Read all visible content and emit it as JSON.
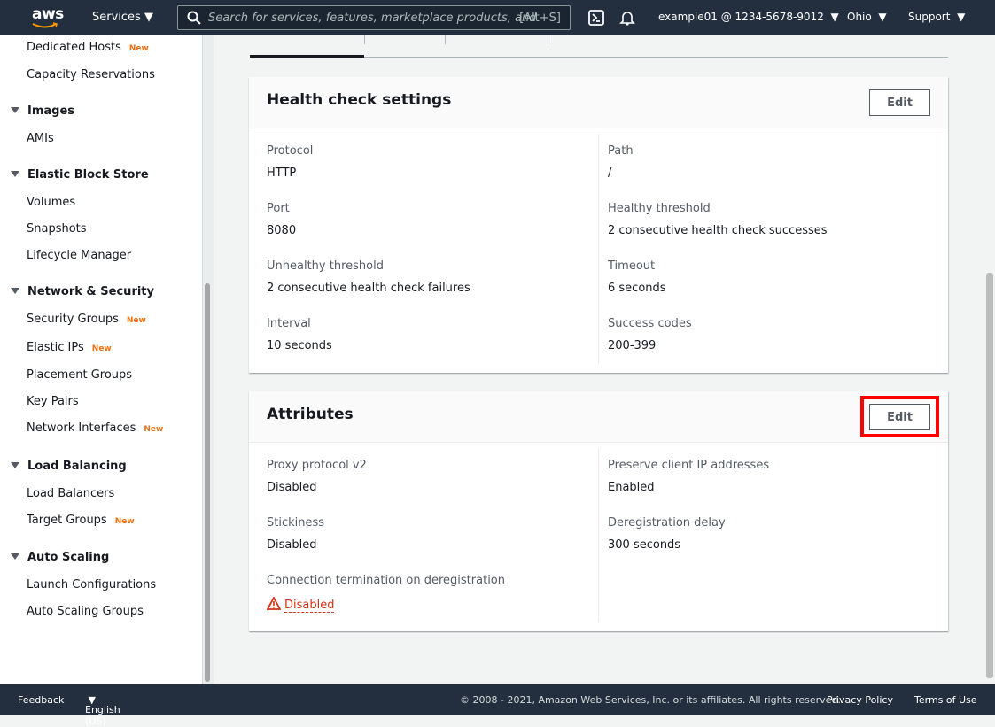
{
  "header": {
    "logo": "aws",
    "services": "Services",
    "search_placeholder": "Search for services, features, marketplace products, and",
    "search_shortcut": "[Alt+S]",
    "account": "example01 @ 1234-5678-9012",
    "region": "Ohio",
    "support": "Support"
  },
  "sidebar": {
    "new_badge": "New",
    "groups": [
      {
        "title": "",
        "items": [
          {
            "label": "Dedicated Hosts",
            "new": true
          },
          {
            "label": "Capacity Reservations"
          }
        ]
      },
      {
        "title": "Images",
        "items": [
          {
            "label": "AMIs"
          }
        ]
      },
      {
        "title": "Elastic Block Store",
        "items": [
          {
            "label": "Volumes"
          },
          {
            "label": "Snapshots"
          },
          {
            "label": "Lifecycle Manager"
          }
        ]
      },
      {
        "title": "Network & Security",
        "items": [
          {
            "label": "Security Groups",
            "new": true
          },
          {
            "label": "Elastic IPs",
            "new": true
          },
          {
            "label": "Placement Groups"
          },
          {
            "label": "Key Pairs"
          },
          {
            "label": "Network Interfaces",
            "new": true
          }
        ]
      },
      {
        "title": "Load Balancing",
        "items": [
          {
            "label": "Load Balancers"
          },
          {
            "label": "Target Groups",
            "new": true
          }
        ]
      },
      {
        "title": "Auto Scaling",
        "items": [
          {
            "label": "Launch Configurations"
          },
          {
            "label": "Auto Scaling Groups"
          }
        ]
      }
    ]
  },
  "health": {
    "title": "Health check settings",
    "edit": "Edit",
    "left": [
      {
        "label": "Protocol",
        "value": "HTTP"
      },
      {
        "label": "Port",
        "value": "8080"
      },
      {
        "label": "Unhealthy threshold",
        "value": "2 consecutive health check failures"
      },
      {
        "label": "Interval",
        "value": "10 seconds"
      }
    ],
    "right": [
      {
        "label": "Path",
        "value": "/"
      },
      {
        "label": "Healthy threshold",
        "value": "2 consecutive health check successes"
      },
      {
        "label": "Timeout",
        "value": "6 seconds"
      },
      {
        "label": "Success codes",
        "value": "200-399"
      }
    ]
  },
  "attributes": {
    "title": "Attributes",
    "edit": "Edit",
    "left": [
      {
        "label": "Proxy protocol v2",
        "value": "Disabled"
      },
      {
        "label": "Stickiness",
        "value": "Disabled"
      },
      {
        "label": "Connection termination on deregistration",
        "value": "Disabled"
      }
    ],
    "right": [
      {
        "label": "Preserve client IP addresses",
        "value": "Enabled"
      },
      {
        "label": "Deregistration delay",
        "value": "300 seconds"
      }
    ],
    "warning_color": "#d13212",
    "highlight_color": "#ff0000"
  },
  "footer": {
    "feedback": "Feedback",
    "language": "English (US)",
    "copyright": "© 2008 - 2021, Amazon Web Services, Inc. or its affiliates. All rights reserved.",
    "privacy": "Privacy Policy",
    "terms": "Terms of Use"
  }
}
